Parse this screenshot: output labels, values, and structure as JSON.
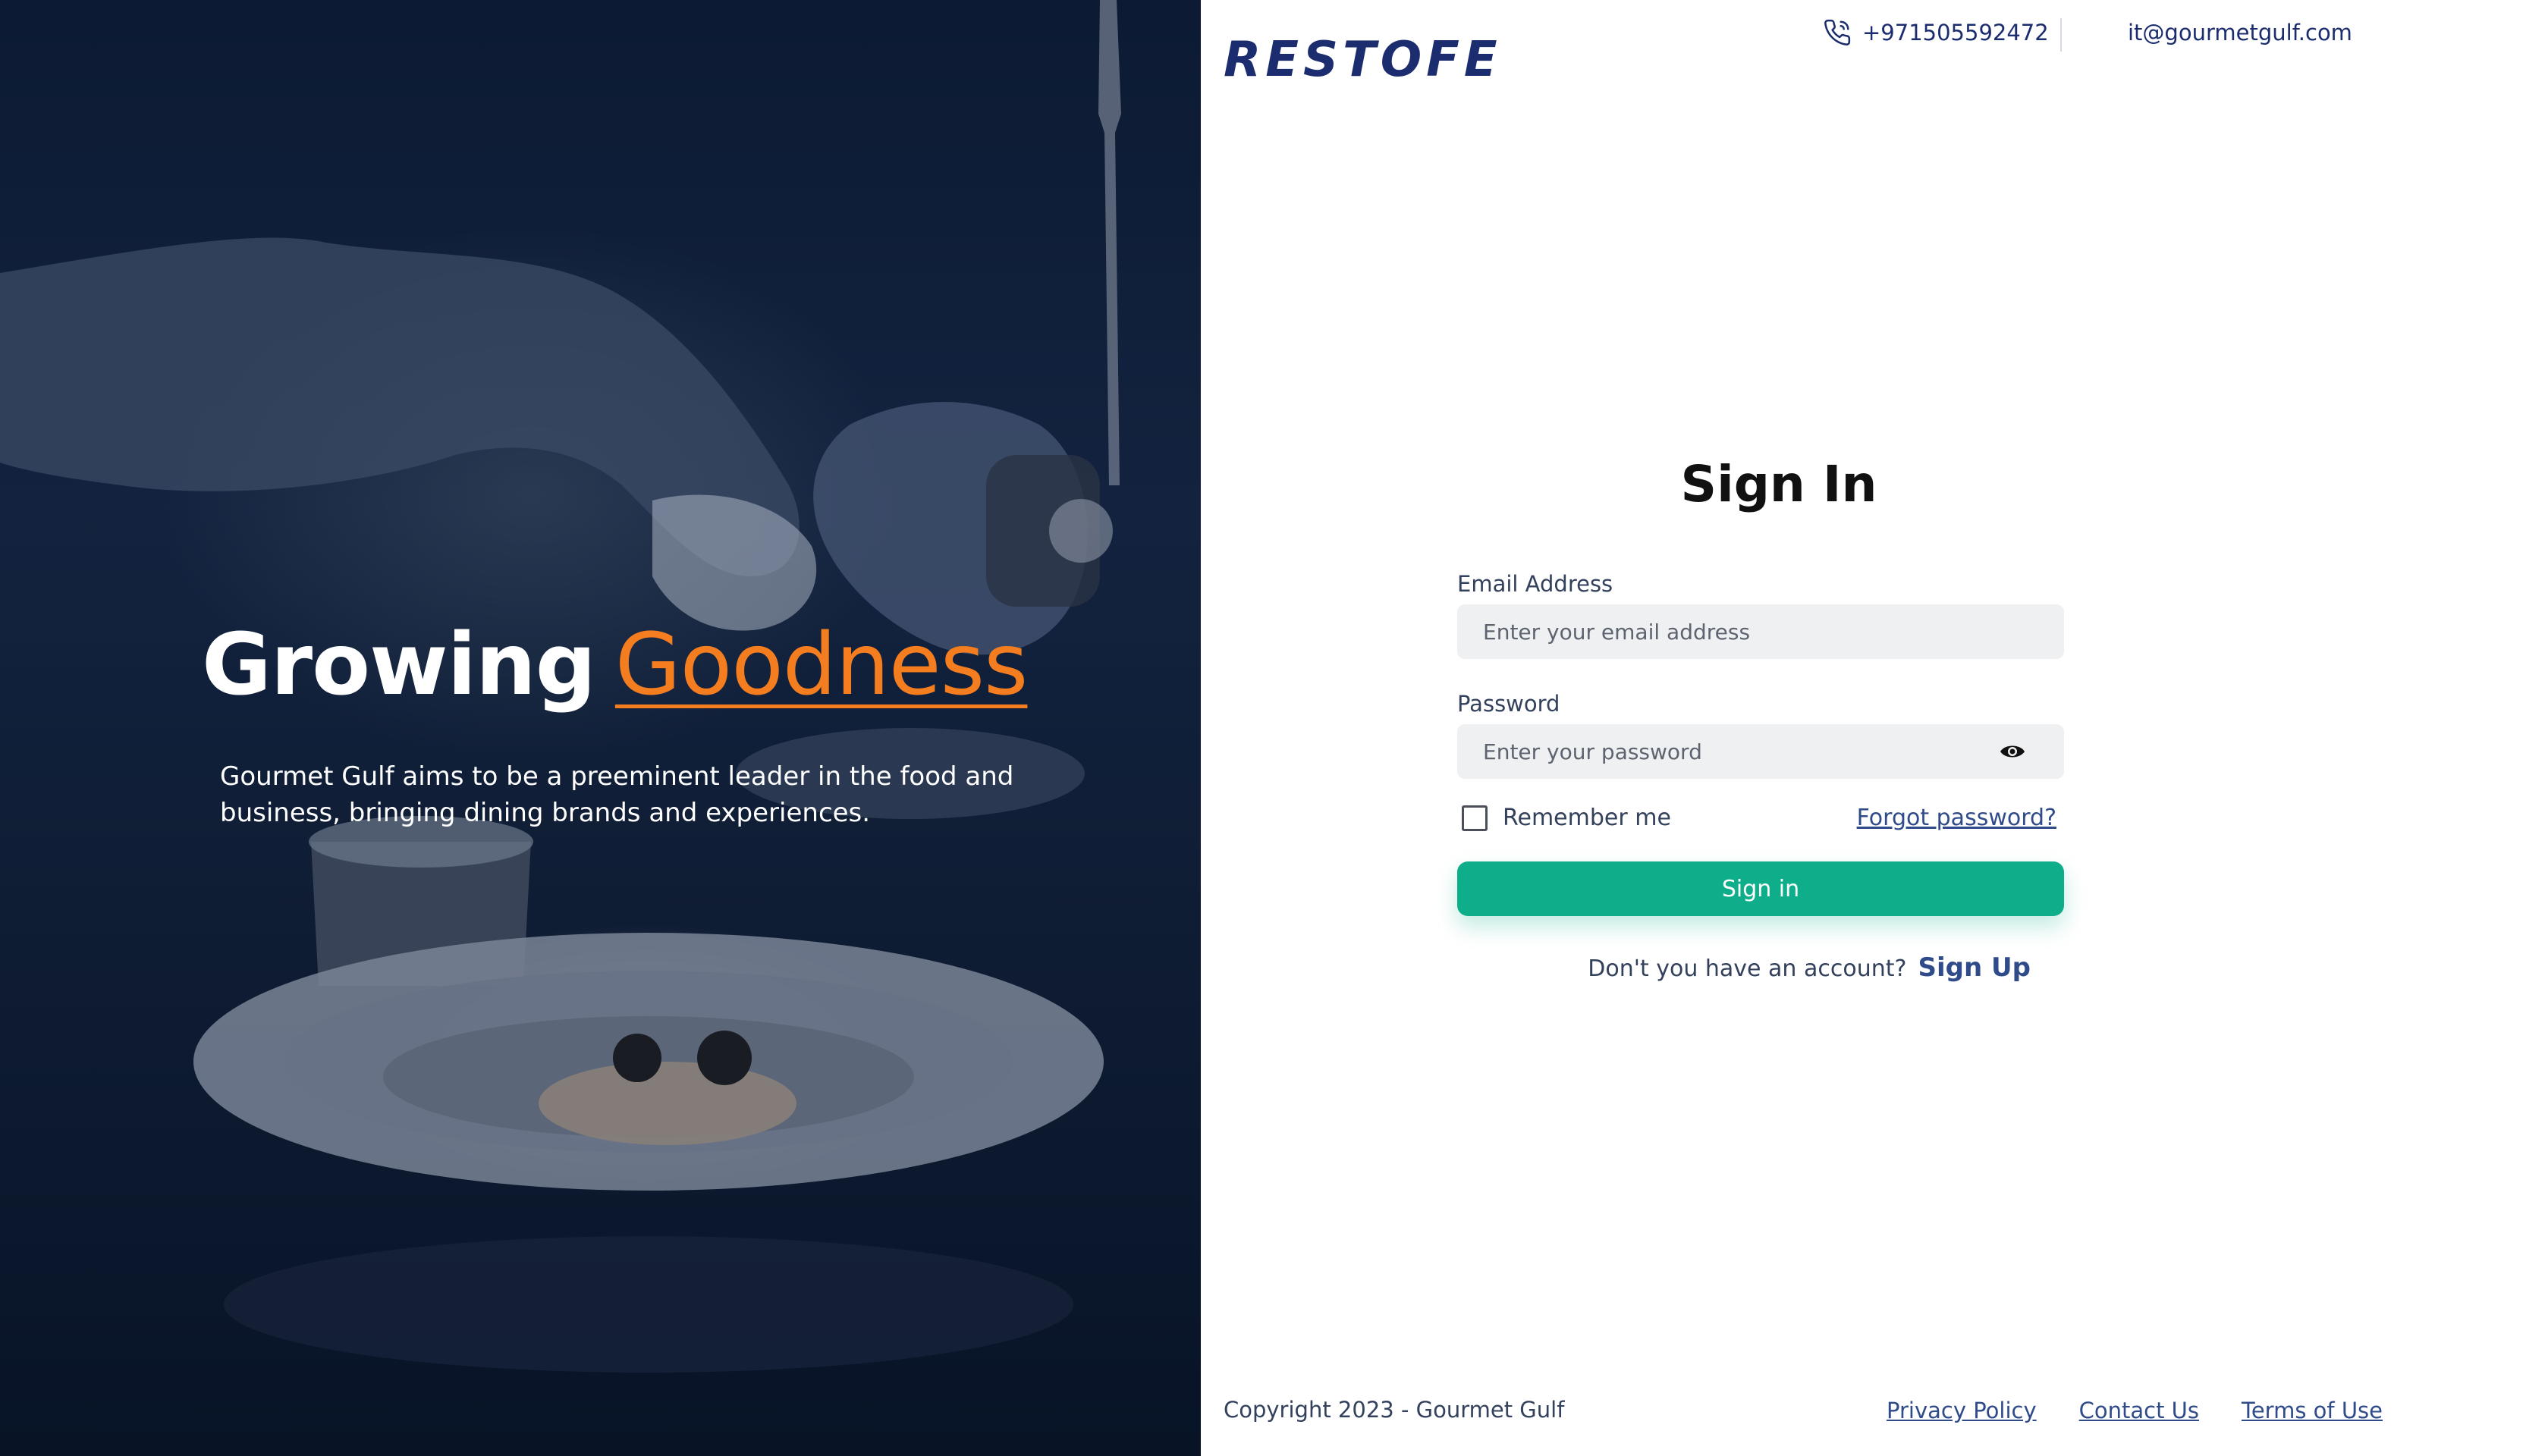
{
  "hero": {
    "title_main": "Growing",
    "title_accent": "Goodness",
    "description": "Gourmet Gulf aims to be a preeminent leader in the food and business, bringing dining brands and experiences.",
    "accent_color": "#f47d20"
  },
  "header": {
    "logo_text": "RESTOFE",
    "phone_icon": "phone-icon",
    "phone": "+971505592472",
    "email": "it@gourmetgulf.com"
  },
  "form": {
    "title": "Sign In",
    "email_label": "Email Address",
    "email_placeholder": "Enter your email address",
    "email_value": "",
    "password_label": "Password",
    "password_placeholder": "Enter your password",
    "password_value": "",
    "password_toggle_icon": "eye-icon",
    "remember_label": "Remember me",
    "remember_checked": false,
    "forgot_label": "Forgot password?",
    "submit_label": "Sign in",
    "signup_prompt": "Don't you have an account?",
    "signup_label": "Sign Up",
    "primary_color": "#0fae8a"
  },
  "footer": {
    "copyright": "Copyright 2023 - Gourmet Gulf",
    "links": [
      "Privacy Policy",
      "Contact Us",
      "Terms of Use"
    ]
  }
}
